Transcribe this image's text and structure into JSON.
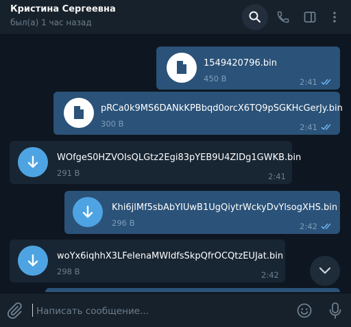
{
  "header": {
    "contact_name": "Кристина Сергеевна",
    "status": "был(а) 1 час назад",
    "icons": [
      "search-icon",
      "phone-icon",
      "sidebar-toggle-icon",
      "more-icon"
    ]
  },
  "colors": {
    "background": "#0e1621",
    "header": "#17212b",
    "outgoing_bubble": "#2b5278",
    "incoming_bubble": "#182533",
    "accent": "#4ea4e2",
    "read_check": "#6ab3f3"
  },
  "messages": [
    {
      "direction": "out",
      "name": "1549420796.bin",
      "size": "450 B",
      "time": "2:41",
      "read": true,
      "icon": "document-icon"
    },
    {
      "direction": "out",
      "name": "pRCa0k9MS6DANkKPBbqd0orcX6TQ9pSGKHcGerJy.bin",
      "size": "300 B",
      "time": "2:41",
      "read": true,
      "icon": "document-icon"
    },
    {
      "direction": "in",
      "name": "WOfgeS0HZVOIsQLGtz2Egi83pYEB9U4ZIDg1GWKB.bin",
      "size": "291 B",
      "time": "2:41",
      "icon": "download-icon"
    },
    {
      "direction": "out",
      "name": "Khi6jlMf5sbAbYIUwB1UgQiytrWckyDvYlsogXHS.bin",
      "size": "296 B",
      "time": "2:42",
      "read": true,
      "icon": "download-icon"
    },
    {
      "direction": "in",
      "name": "woYx6iqhhX3LFeIenaMWIdfsSkpQfrOCQtzEUJat.bin",
      "size": "298 B",
      "time": "2:42",
      "icon": "download-icon"
    }
  ],
  "composer": {
    "placeholder": "Написать сообщение...",
    "value": ""
  }
}
